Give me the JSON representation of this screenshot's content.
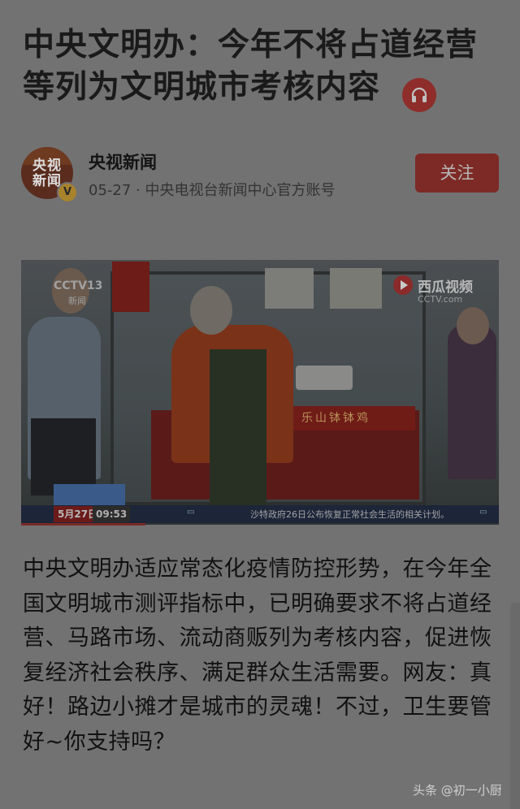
{
  "article": {
    "title": "中央文明办：今年不将占道经营等列为文明城市考核内容",
    "body": "中央文明办适应常态化疫情防控形势，在今年全国文明城市测评指标中，已明确要求不将占道经营、马路市场、流动商贩列为考核内容，促进恢复经济社会秩序、满足群众生活需要。网友：真好！路边小摊才是城市的灵魂！不过，卫生要管好~你支持吗？"
  },
  "author": {
    "avatar_text": "央视新闻",
    "name": "央视新闻",
    "meta": "05-27 · 中央电视台新闻中心官方账号",
    "verified_icon": "v-badge-icon",
    "follow_label": "关注"
  },
  "video": {
    "channel_logo": "CCTV13",
    "channel_sub": "新闻",
    "xigua_label": "西瓜视频",
    "xigua_sub": "CCTV.com",
    "stall_sign": "乐山钵钵鸡",
    "date": "5月27日",
    "time": "09:53",
    "ticker": "沙特政府26日公布恢复正常社会生活的相关计划。",
    "progress": 0.26
  },
  "watermark": "头条 @初一小厨",
  "colors": {
    "accent": "#7d2a26",
    "overlay_background": "#727272"
  }
}
